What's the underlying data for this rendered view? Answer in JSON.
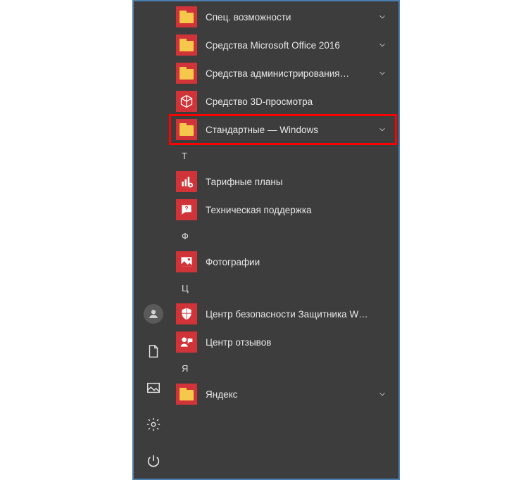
{
  "colors": {
    "panel_bg": "#3d3d3d",
    "panel_border": "#4a7fb0",
    "tile_red": "#d13438",
    "highlight": "#ff0000",
    "text": "#e8e8e8"
  },
  "rail": {
    "user": "user",
    "documents": "documents",
    "pictures": "pictures",
    "settings": "settings",
    "power": "power"
  },
  "items": [
    {
      "type": "folder",
      "label": "Спец. возможности",
      "expandable": true
    },
    {
      "type": "folder",
      "label": "Средства Microsoft Office 2016",
      "expandable": true
    },
    {
      "type": "folder",
      "label": "Средства администрирования…",
      "expandable": true
    },
    {
      "type": "app",
      "icon": "cube",
      "label": "Средство 3D-просмотра",
      "expandable": false
    },
    {
      "type": "folder",
      "label": "Стандартные — Windows",
      "expandable": true,
      "highlighted": true
    },
    {
      "type": "header",
      "label": "Т"
    },
    {
      "type": "app",
      "icon": "bars-plus",
      "label": "Тарифные планы",
      "expandable": false
    },
    {
      "type": "app",
      "icon": "chat-question",
      "label": "Техническая поддержка",
      "expandable": false
    },
    {
      "type": "header",
      "label": "Ф"
    },
    {
      "type": "app",
      "icon": "photo",
      "label": "Фотографии",
      "expandable": false
    },
    {
      "type": "header",
      "label": "Ц"
    },
    {
      "type": "app",
      "icon": "shield",
      "label": "Центр безопасности Защитника W…",
      "expandable": false
    },
    {
      "type": "app",
      "icon": "feedback",
      "label": "Центр отзывов",
      "expandable": false
    },
    {
      "type": "header",
      "label": "Я"
    },
    {
      "type": "folder",
      "label": "Яндекс",
      "expandable": true
    }
  ]
}
